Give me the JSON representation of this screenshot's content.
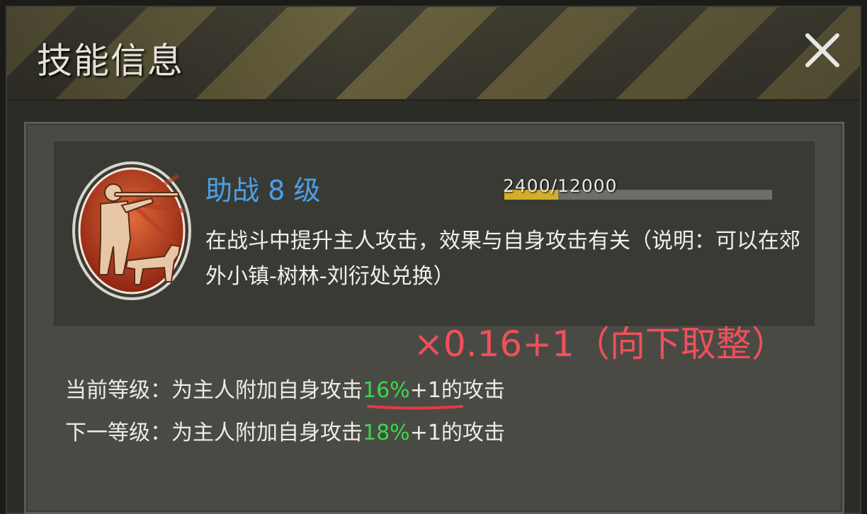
{
  "dialog": {
    "title": "技能信息",
    "close_icon": "close-icon"
  },
  "skill": {
    "name": "助战 8 级",
    "progress_text": "2400/12000",
    "progress_current": 2400,
    "progress_max": 12000,
    "description": "在战斗中提升主人攻击，效果与自身攻击有关（说明：可以在郊外小镇-树林-刘衍处兑换）",
    "icon": "hunter-with-dog-icon"
  },
  "annotation": {
    "note": "×0.16+1（向下取整）",
    "color": "#f0505a"
  },
  "levels": {
    "current": {
      "prefix": "当前等级：为主人附加自身攻击",
      "percent": "16%",
      "suffix": "+1的攻击"
    },
    "next": {
      "prefix": "下一等级：为主人附加自身攻击",
      "percent": "18%",
      "suffix": "+1的攻击"
    }
  },
  "colors": {
    "skill_name": "#4aa0e8",
    "percent_green": "#39d94a",
    "progress_fill": "#d4ae2a"
  }
}
